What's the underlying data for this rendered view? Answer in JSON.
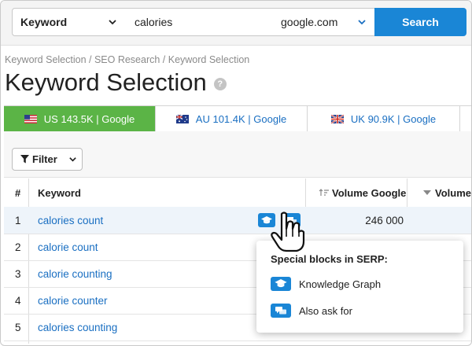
{
  "search": {
    "type_value": "Keyword",
    "query_value": "calories",
    "engine_value": "google.com",
    "button_label": "Search"
  },
  "breadcrumb": "Keyword Selection / SEO Research / Keyword Selection",
  "page_title": "Keyword Selection",
  "help_glyph": "?",
  "db_tabs": [
    {
      "label": "US 143.5K | Google",
      "flag": "us-flag-icon",
      "active": true
    },
    {
      "label": "AU 101.4K | Google",
      "flag": "au-flag-icon",
      "active": false
    },
    {
      "label": "UK 90.9K | Google",
      "flag": "uk-flag-icon",
      "active": false
    }
  ],
  "filter_label": "Filter",
  "table": {
    "columns": [
      "#",
      "Keyword",
      "Volume Google",
      "Volume"
    ],
    "rows": [
      {
        "num": "1",
        "keyword": "calories count",
        "volume": "246 000"
      },
      {
        "num": "2",
        "keyword": "calorie count",
        "volume": ""
      },
      {
        "num": "3",
        "keyword": "calorie counting",
        "volume": ""
      },
      {
        "num": "4",
        "keyword": "calorie counter",
        "volume": ""
      },
      {
        "num": "5",
        "keyword": "calories counting",
        "volume": ""
      }
    ]
  },
  "serp_popover": {
    "title": "Special blocks in SERP:",
    "items": [
      {
        "label": "Knowledge Graph",
        "icon": "graduation-cap-icon"
      },
      {
        "label": "Also ask for",
        "icon": "chat-bubbles-icon"
      }
    ]
  },
  "colors": {
    "accent": "#1a86d6",
    "active_tab": "#5bb446",
    "link": "#1a6fc2"
  }
}
